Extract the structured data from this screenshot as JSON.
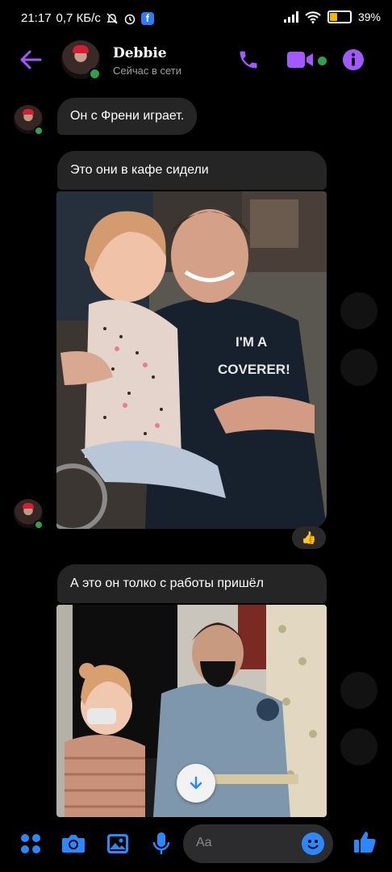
{
  "status_bar": {
    "time": "21:17",
    "speed": "0,7 КБ/с",
    "battery_pct": "39%",
    "battery_level": 0.39
  },
  "header": {
    "contact_name": "Debbie",
    "status": "Сейчас в сети"
  },
  "messages": [
    {
      "type": "text",
      "text": "Он с Френи играет."
    },
    {
      "type": "text",
      "text": "Это они в кафе сидели"
    },
    {
      "type": "image",
      "shirt_text_1": "I'M A",
      "shirt_text_2": "COVERER!",
      "reaction": "👍"
    },
    {
      "type": "text",
      "text": "А это он толко с работы пришёл"
    },
    {
      "type": "image"
    }
  ],
  "composer": {
    "placeholder": "Aa"
  },
  "colors": {
    "accent": "#a259ff",
    "blue": "#2d88ff",
    "bubble": "#252526",
    "online": "#31a24c"
  }
}
